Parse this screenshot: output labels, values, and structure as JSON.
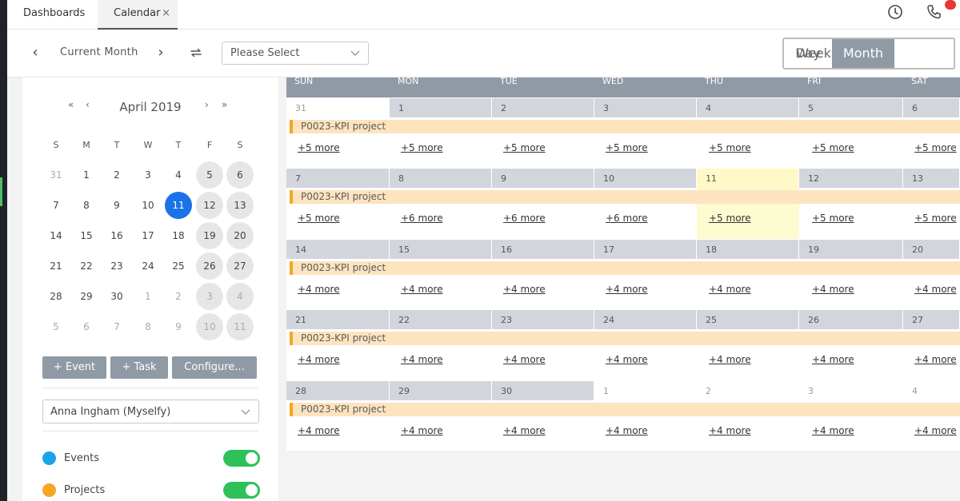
{
  "tabs": [
    {
      "label": "Dashboards"
    },
    {
      "label": "Calendar",
      "close": "×"
    }
  ],
  "toolbar": {
    "prev": "‹",
    "next": "›",
    "current_month": "Current Month",
    "select_value": "Please Select",
    "views": [
      "Day",
      "Week",
      "Month"
    ],
    "active_view": "Month"
  },
  "mini_calendar": {
    "nav_first": "«",
    "nav_prev": "‹",
    "nav_next": "›",
    "nav_last": "»",
    "title": "April 2019",
    "weekdays": [
      "S",
      "M",
      "T",
      "W",
      "T",
      "F",
      "S"
    ],
    "weeks": [
      [
        "31",
        "1",
        "2",
        "3",
        "4",
        "5",
        "6"
      ],
      [
        "7",
        "8",
        "9",
        "10",
        "11",
        "12",
        "13"
      ],
      [
        "14",
        "15",
        "16",
        "17",
        "18",
        "19",
        "20"
      ],
      [
        "21",
        "22",
        "23",
        "24",
        "25",
        "26",
        "27"
      ],
      [
        "28",
        "29",
        "30",
        "1",
        "2",
        "3",
        "4"
      ],
      [
        "5",
        "6",
        "7",
        "8",
        "9",
        "10",
        "11"
      ]
    ],
    "today": "11"
  },
  "sidebar": {
    "buttons": [
      "+ Event",
      "+ Task",
      "Configure..."
    ],
    "user_select": "Anna Ingham (Myselfy)",
    "legend": [
      {
        "label": "Events",
        "color": "#1aa3e8"
      },
      {
        "label": "Projects",
        "color": "#f5a623"
      }
    ]
  },
  "calendar": {
    "weekdays": [
      "SUN",
      "MON",
      "TUE",
      "WED",
      "THU",
      "FRI",
      "SAT"
    ],
    "event_label": "P0023-KPI project",
    "weeks": [
      {
        "days": [
          "31",
          "1",
          "2",
          "3",
          "4",
          "5",
          "6"
        ],
        "more": [
          "+5 more",
          "+5 more",
          "+5 more",
          "+5 more",
          "+5 more",
          "+5 more",
          "+5 more"
        ]
      },
      {
        "days": [
          "7",
          "8",
          "9",
          "10",
          "11",
          "12",
          "13"
        ],
        "more": [
          "+5 more",
          "+6 more",
          "+6 more",
          "+6 more",
          "+5 more",
          "+5 more",
          "+5 more"
        ]
      },
      {
        "days": [
          "14",
          "15",
          "16",
          "17",
          "18",
          "19",
          "20"
        ],
        "more": [
          "+4 more",
          "+4 more",
          "+4 more",
          "+4 more",
          "+4 more",
          "+4 more",
          "+4 more"
        ]
      },
      {
        "days": [
          "21",
          "22",
          "23",
          "24",
          "25",
          "26",
          "27"
        ],
        "more": [
          "+4 more",
          "+4 more",
          "+4 more",
          "+4 more",
          "+4 more",
          "+4 more",
          "+4 more"
        ]
      },
      {
        "days": [
          "28",
          "29",
          "30",
          "1",
          "2",
          "3",
          "4"
        ],
        "more": [
          "+4 more",
          "+4 more",
          "+4 more",
          "+4 more",
          "+4 more",
          "+4 more",
          "+4 more"
        ]
      }
    ]
  },
  "colors": {
    "accent": "#8f9aa5",
    "today": "#1a73e8",
    "event_bar": "#fde4bf",
    "event_border": "#f5a623",
    "toggle_on": "#2ec05a"
  }
}
